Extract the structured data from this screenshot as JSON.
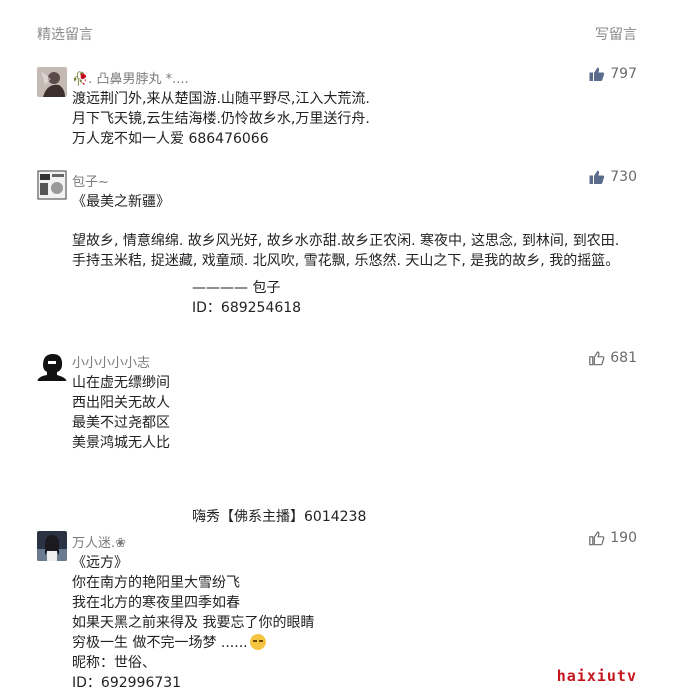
{
  "header": {
    "title": "精选留言",
    "write_label": "写留言"
  },
  "comments": [
    {
      "nickname": "🥀. 凸鼻男脖丸 *....",
      "likes": "797",
      "liked": true,
      "lines": [
        "渡远荆门外,来从楚国游.山随平野尽,江入大荒流.",
        "月下飞天镜,云生结海楼.仍怜故乡水,万里送行舟.",
        "万人宠不如一人爱 686476066"
      ]
    },
    {
      "nickname": "包子~",
      "likes": "730",
      "liked": true,
      "title": "《最美之新疆》",
      "paragraph": "望故乡, 情意绵绵. 故乡风光好, 故乡水亦甜.故乡正农闲. 寒夜中, 这思念, 到林间, 到农田. 手持玉米秸, 捉迷藏, 戏童顽. 北风吹, 雪花飘, 乐悠然. 天山之下, 是我的故乡, 我的摇篮。",
      "sign1": "———— 包子",
      "sign2": "ID：689254618"
    },
    {
      "nickname": "小小小小小志",
      "likes": "681",
      "liked": false,
      "lines": [
        "山在虚无缥缈间",
        "西出阳关无故人",
        "最美不过尧都区",
        "美景鸿城无人比"
      ],
      "sign": "嗨秀【佛系主播】6014238"
    },
    {
      "nickname": "万人迷.❀",
      "likes": "190",
      "liked": false,
      "lines": [
        "《远方》",
        "你在南方的艳阳里大雪纷飞",
        "我在北方的寒夜里四季如春",
        "如果天黑之前来得及 我要忘了你的眼睛",
        "穷极一生  做不完一场梦 ......",
        "昵称：世俗、",
        "ID：692996731"
      ]
    }
  ],
  "watermark": "haixiutv",
  "colors": {
    "meta": "#8a8a8a",
    "text": "#222222",
    "watermark": "#c4161c"
  }
}
